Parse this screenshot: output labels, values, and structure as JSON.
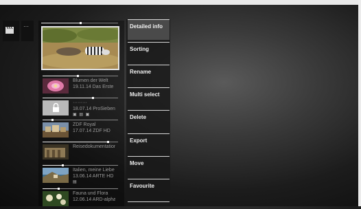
{
  "menu": {
    "items": [
      {
        "label": "Detailed info",
        "active": true
      },
      {
        "label": "Sorting"
      },
      {
        "label": "Rename"
      },
      {
        "label": "Multi select"
      },
      {
        "label": "Delete"
      },
      {
        "label": "Export"
      },
      {
        "label": "Move"
      },
      {
        "label": "Favourite"
      }
    ]
  },
  "sidebar": {
    "icon": "clapperboard-icon",
    "more_label": "···"
  },
  "recordings": [
    {
      "title": "Blumen der Welt",
      "subtitle": "19.11.14 Das Erste",
      "progress": 0.45,
      "thumb": "flower"
    },
    {
      "title": "·········",
      "subtitle": "18.07.14 ProSieben",
      "icons": "▣ ▤ ▣",
      "progress": 0.65,
      "locked": true
    },
    {
      "title": "ZDF Royal",
      "subtitle": "17.07.14 ZDF HD",
      "progress": 0.12,
      "thumb": "city"
    },
    {
      "title": "Reisedokumentation",
      "subtitle": "",
      "progress": 0.85,
      "thumb": "ruins"
    },
    {
      "title": "Italien, meine Liebe",
      "subtitle": "13.06.14 ARTE HD",
      "icons": "▤",
      "progress": 0.25,
      "thumb": "coast"
    },
    {
      "title": "Fauna und Flora",
      "subtitle": "12.06.14 ARD-alpha",
      "progress": 0.2,
      "thumb": "flowers2"
    }
  ],
  "preview": {
    "progress": 0.5
  }
}
